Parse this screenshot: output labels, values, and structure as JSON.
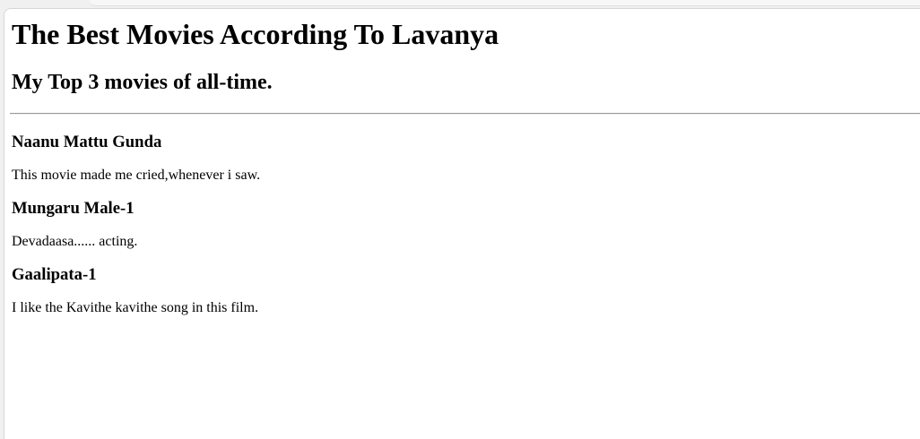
{
  "page": {
    "title": "The Best Movies According To Lavanya",
    "subtitle": "My Top 3 movies of all-time."
  },
  "movies": [
    {
      "name": "Naanu Mattu Gunda",
      "comment": "This movie made me cried,whenever i saw."
    },
    {
      "name": "Mungaru Male-1",
      "comment": "Devadaasa...... acting."
    },
    {
      "name": "Gaalipata-1",
      "comment": "I like the Kavithe kavithe song in this film."
    }
  ]
}
